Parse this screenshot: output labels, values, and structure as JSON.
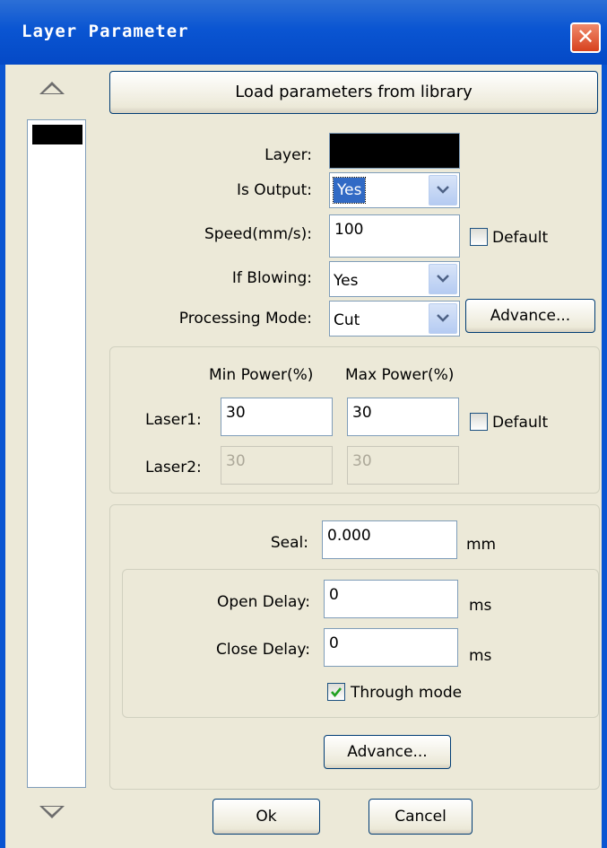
{
  "window": {
    "title": "Layer Parameter",
    "close_glyph": "✕"
  },
  "layer_list": {
    "up_icon": "triangle-up-icon",
    "down_icon": "triangle-down-icon",
    "selected_layer_color": "#000000"
  },
  "buttons": {
    "load": "Load parameters from library",
    "advance_processing": "Advance...",
    "advance_seal": "Advance...",
    "ok": "Ok",
    "cancel": "Cancel"
  },
  "general": {
    "layer_label": "Layer:",
    "layer_color": "#000000",
    "is_output_label": "Is Output:",
    "is_output_value": "Yes",
    "speed_label": "Speed(mm/s):",
    "speed_value": "100",
    "speed_default_label": "Default",
    "speed_default_checked": false,
    "if_blowing_label": "If Blowing:",
    "if_blowing_value": "Yes",
    "processing_mode_label": "Processing Mode:",
    "processing_mode_value": "Cut"
  },
  "power": {
    "min_header": "Min Power(%)",
    "max_header": "Max Power(%)",
    "laser1_label": "Laser1:",
    "laser1_min": "30",
    "laser1_max": "30",
    "laser1_default_label": "Default",
    "laser1_default_checked": false,
    "laser2_label": "Laser2:",
    "laser2_min": "30",
    "laser2_max": "30"
  },
  "seal": {
    "seal_label": "Seal:",
    "seal_value": "0.000",
    "seal_unit": "mm",
    "open_delay_label": "Open Delay:",
    "open_delay_value": "0",
    "open_delay_unit": "ms",
    "close_delay_label": "Close Delay:",
    "close_delay_value": "0",
    "close_delay_unit": "ms",
    "through_mode_label": "Through mode",
    "through_mode_checked": true
  },
  "colors": {
    "titlebar": "#0a55d2",
    "dialog_bg": "#ece9d8",
    "selection": "#316ac5",
    "checkmark": "#21a121"
  }
}
